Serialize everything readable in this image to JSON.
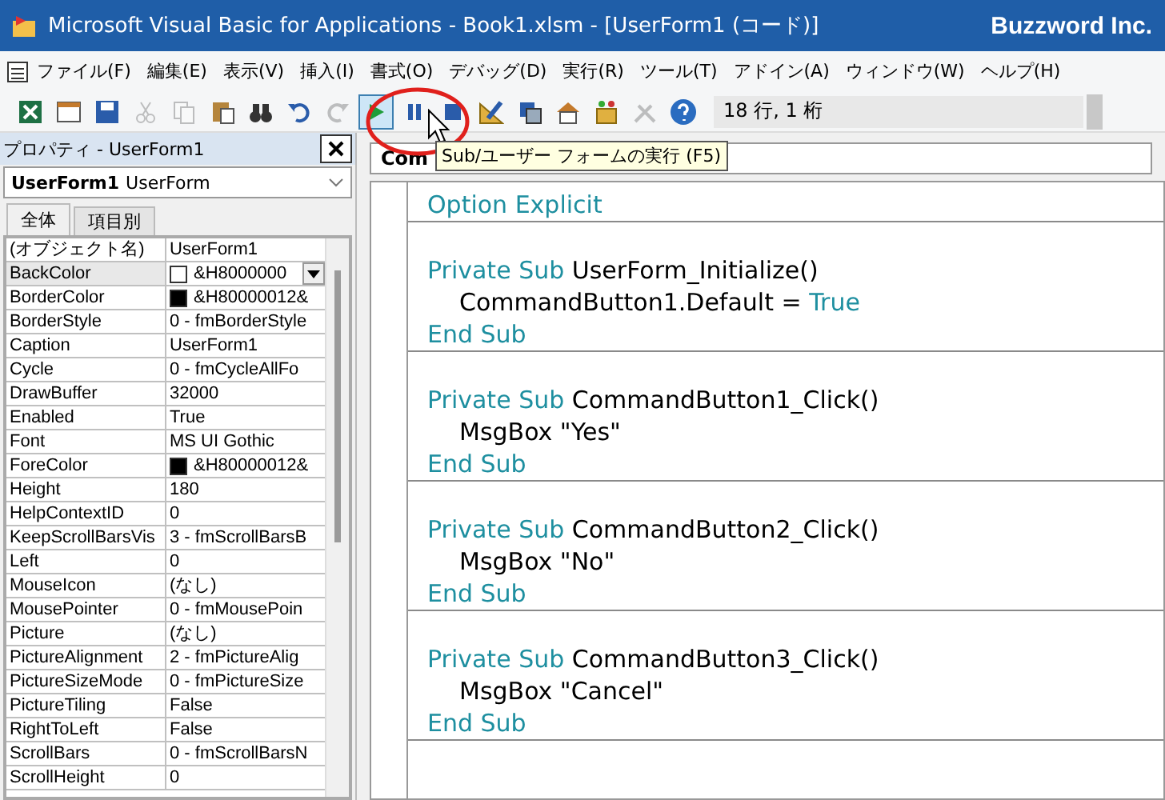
{
  "window": {
    "title": "Microsoft Visual Basic for Applications - Book1.xlsm - [UserForm1 (コード)]",
    "brand": "Buzzword Inc."
  },
  "menu": [
    "ファイル(F)",
    "編集(E)",
    "表示(V)",
    "挿入(I)",
    "書式(O)",
    "デバッグ(D)",
    "実行(R)",
    "ツール(T)",
    "アドイン(A)",
    "ウィンドウ(W)",
    "ヘルプ(H)"
  ],
  "toolbar": {
    "buttons": [
      {
        "kind": "excel",
        "disabled": false,
        "selected": false
      },
      {
        "kind": "insert",
        "disabled": false,
        "selected": false
      },
      {
        "kind": "save",
        "disabled": false,
        "selected": false
      },
      {
        "kind": "cut",
        "disabled": true,
        "selected": false
      },
      {
        "kind": "copy",
        "disabled": true,
        "selected": false
      },
      {
        "kind": "paste",
        "disabled": false,
        "selected": false
      },
      {
        "kind": "find",
        "disabled": false,
        "selected": false
      },
      {
        "kind": "undo",
        "disabled": false,
        "selected": false
      },
      {
        "kind": "redo",
        "disabled": true,
        "selected": false
      },
      {
        "kind": "run",
        "disabled": false,
        "selected": true
      },
      {
        "kind": "pause",
        "disabled": false,
        "selected": false
      },
      {
        "kind": "stop",
        "disabled": false,
        "selected": false
      },
      {
        "kind": "design",
        "disabled": false,
        "selected": false
      },
      {
        "kind": "project",
        "disabled": false,
        "selected": false
      },
      {
        "kind": "properties",
        "disabled": false,
        "selected": false
      },
      {
        "kind": "objects",
        "disabled": false,
        "selected": false
      },
      {
        "kind": "tools",
        "disabled": true,
        "selected": false
      },
      {
        "kind": "help",
        "disabled": false,
        "selected": false
      }
    ],
    "position": "18 行, 1 桁"
  },
  "properties": {
    "title": "プロパティ - UserForm1",
    "object_name": "UserForm1",
    "object_type": "UserForm",
    "tabs": [
      {
        "label": "全体",
        "selected": true
      },
      {
        "label": "項目別",
        "selected": false
      }
    ],
    "rows": [
      {
        "name": "(オブジェクト名)",
        "value": "UserForm1",
        "selected": false
      },
      {
        "name": "BackColor",
        "value": "&H8000000",
        "color": "#ffffff",
        "selected": true
      },
      {
        "name": "BorderColor",
        "value": "&H80000012&",
        "color": "#000000",
        "selected": false
      },
      {
        "name": "BorderStyle",
        "value": "0 - fmBorderStyle",
        "selected": false
      },
      {
        "name": "Caption",
        "value": "UserForm1",
        "selected": false
      },
      {
        "name": "Cycle",
        "value": "0 - fmCycleAllFo",
        "selected": false
      },
      {
        "name": "DrawBuffer",
        "value": "32000",
        "selected": false
      },
      {
        "name": "Enabled",
        "value": "True",
        "selected": false
      },
      {
        "name": "Font",
        "value": "MS UI Gothic",
        "selected": false
      },
      {
        "name": "ForeColor",
        "value": "&H80000012&",
        "color": "#000000",
        "selected": false
      },
      {
        "name": "Height",
        "value": "180",
        "selected": false
      },
      {
        "name": "HelpContextID",
        "value": "0",
        "selected": false
      },
      {
        "name": "KeepScrollBarsVis",
        "value": "3 - fmScrollBarsB",
        "selected": false
      },
      {
        "name": "Left",
        "value": "0",
        "selected": false
      },
      {
        "name": "MouseIcon",
        "value": "(なし)",
        "selected": false
      },
      {
        "name": "MousePointer",
        "value": "0 - fmMousePoin",
        "selected": false
      },
      {
        "name": "Picture",
        "value": "(なし)",
        "selected": false
      },
      {
        "name": "PictureAlignment",
        "value": "2 - fmPictureAlig",
        "selected": false
      },
      {
        "name": "PictureSizeMode",
        "value": "0 - fmPictureSize",
        "selected": false
      },
      {
        "name": "PictureTiling",
        "value": "False",
        "selected": false
      },
      {
        "name": "RightToLeft",
        "value": "False",
        "selected": false
      },
      {
        "name": "ScrollBars",
        "value": "0 - fmScrollBarsN",
        "selected": false
      },
      {
        "name": "ScrollHeight",
        "value": "0",
        "selected": false
      }
    ]
  },
  "code": {
    "object_combo": "Com",
    "tooltip": "Sub/ユーザー フォームの実行 (F5)",
    "sections": [
      {
        "lines": [
          {
            "indented": false,
            "tokens": [
              {
                "kind": "keyword",
                "text": "Option Explicit"
              }
            ]
          }
        ]
      },
      {
        "lines": [
          {
            "indented": false,
            "tokens": [
              {
                "kind": "keyword",
                "text": "Private Sub"
              },
              {
                "kind": "plain",
                "text": " UserForm_Initialize()"
              }
            ]
          },
          {
            "indented": true,
            "tokens": [
              {
                "kind": "plain",
                "text": "CommandButton1.Default = "
              },
              {
                "kind": "keyword",
                "text": "True"
              }
            ]
          },
          {
            "indented": false,
            "tokens": [
              {
                "kind": "keyword",
                "text": "End Sub"
              }
            ]
          }
        ]
      },
      {
        "lines": [
          {
            "indented": false,
            "tokens": [
              {
                "kind": "keyword",
                "text": "Private Sub"
              },
              {
                "kind": "plain",
                "text": " CommandButton1_Click()"
              }
            ]
          },
          {
            "indented": true,
            "tokens": [
              {
                "kind": "plain",
                "text": "MsgBox \"Yes\""
              }
            ]
          },
          {
            "indented": false,
            "tokens": [
              {
                "kind": "keyword",
                "text": "End Sub"
              }
            ]
          }
        ]
      },
      {
        "lines": [
          {
            "indented": false,
            "tokens": [
              {
                "kind": "keyword",
                "text": "Private Sub"
              },
              {
                "kind": "plain",
                "text": " CommandButton2_Click()"
              }
            ]
          },
          {
            "indented": true,
            "tokens": [
              {
                "kind": "plain",
                "text": "MsgBox \"No\""
              }
            ]
          },
          {
            "indented": false,
            "tokens": [
              {
                "kind": "keyword",
                "text": "End Sub"
              }
            ]
          }
        ]
      },
      {
        "lines": [
          {
            "indented": false,
            "tokens": [
              {
                "kind": "keyword",
                "text": "Private Sub"
              },
              {
                "kind": "plain",
                "text": " CommandButton3_Click()"
              }
            ]
          },
          {
            "indented": true,
            "tokens": [
              {
                "kind": "plain",
                "text": "MsgBox \"Cancel\""
              }
            ]
          },
          {
            "indented": false,
            "tokens": [
              {
                "kind": "keyword",
                "text": "End Sub"
              }
            ]
          }
        ]
      }
    ]
  }
}
